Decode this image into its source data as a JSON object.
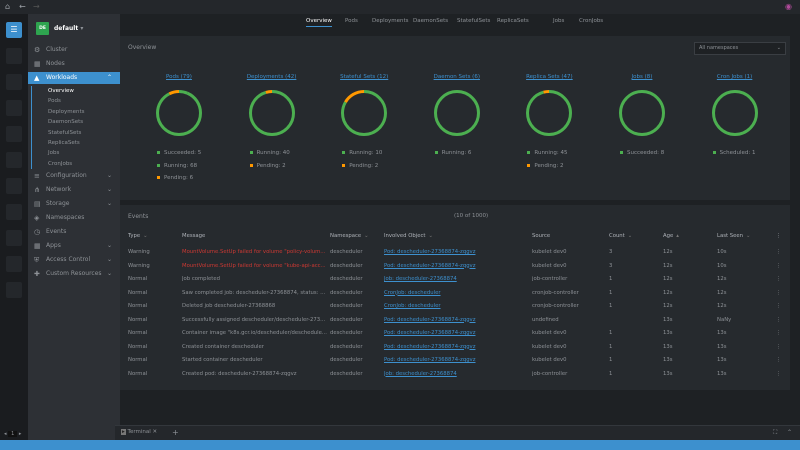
{
  "topbar": {
    "home_icon": "home-icon",
    "back_icon": "arrow-left-icon",
    "forward_icon": "arrow-right-icon"
  },
  "cluster": {
    "badge": "DE",
    "name": "default"
  },
  "sidebar": {
    "items": [
      {
        "label": "Cluster",
        "icon": "cluster-icon"
      },
      {
        "label": "Nodes",
        "icon": "nodes-icon"
      },
      {
        "label": "Workloads",
        "icon": "workloads-icon",
        "active": true
      },
      {
        "label": "Configuration",
        "icon": "configuration-icon"
      },
      {
        "label": "Network",
        "icon": "network-icon"
      },
      {
        "label": "Storage",
        "icon": "storage-icon"
      },
      {
        "label": "Namespaces",
        "icon": "namespaces-icon"
      },
      {
        "label": "Events",
        "icon": "events-icon"
      },
      {
        "label": "Apps",
        "icon": "apps-icon"
      },
      {
        "label": "Access Control",
        "icon": "access-control-icon"
      },
      {
        "label": "Custom Resources",
        "icon": "custom-resources-icon"
      }
    ],
    "workloads_sub": [
      "Overview",
      "Pods",
      "Deployments",
      "DaemonSets",
      "StatefulSets",
      "ReplicaSets",
      "Jobs",
      "CronJobs"
    ]
  },
  "tabs": [
    "Overview",
    "Pods",
    "Deployments",
    "DaemonSets",
    "StatefulSets",
    "ReplicaSets",
    "Jobs",
    "CronJobs"
  ],
  "overview": {
    "title": "Overview",
    "namespace_select": "All namespaces",
    "colors": {
      "green": "#4caf50",
      "orange": "#ff9800"
    },
    "cards": [
      {
        "title": "Pods (79)",
        "stats": [
          {
            "label": "Succeeded: 5",
            "v": 5,
            "c": "green"
          },
          {
            "label": "Running: 68",
            "v": 68,
            "c": "green"
          },
          {
            "label": "Pending: 6",
            "v": 6,
            "c": "orange"
          }
        ]
      },
      {
        "title": "Deployments (42)",
        "stats": [
          {
            "label": "Running: 40",
            "v": 40,
            "c": "green"
          },
          {
            "label": "Pending: 2",
            "v": 2,
            "c": "orange"
          }
        ]
      },
      {
        "title": "Stateful Sets (12)",
        "stats": [
          {
            "label": "Running: 10",
            "v": 10,
            "c": "green"
          },
          {
            "label": "Pending: 2",
            "v": 2,
            "c": "orange"
          }
        ]
      },
      {
        "title": "Daemon Sets (6)",
        "stats": [
          {
            "label": "Running: 6",
            "v": 6,
            "c": "green"
          }
        ]
      },
      {
        "title": "Replica Sets (47)",
        "stats": [
          {
            "label": "Running: 45",
            "v": 45,
            "c": "green"
          },
          {
            "label": "Pending: 2",
            "v": 2,
            "c": "orange"
          }
        ]
      },
      {
        "title": "Jobs (8)",
        "stats": [
          {
            "label": "Succeeded: 8",
            "v": 8,
            "c": "green"
          }
        ]
      },
      {
        "title": "Cron Jobs (1)",
        "stats": [
          {
            "label": "Scheduled: 1",
            "v": 1,
            "c": "green"
          }
        ]
      }
    ]
  },
  "events": {
    "title": "Events",
    "count": "(10 of 1000)",
    "columns": [
      "Type",
      "Message",
      "Namespace",
      "Involved Object",
      "Source",
      "Count",
      "Age",
      "Last Seen"
    ],
    "rows": [
      [
        "Warning",
        "MountVolume.SetUp failed for volume \"policy-volum...",
        "descheduler",
        "Pod: descheduler-27368874-zqgvz",
        "kubelet dev0",
        "3",
        "12s",
        "10s"
      ],
      [
        "Warning",
        "MountVolume.SetUp failed for volume \"kube-api-acc...",
        "descheduler",
        "Pod: descheduler-27368874-zqgvz",
        "kubelet dev0",
        "3",
        "12s",
        "10s"
      ],
      [
        "Normal",
        "Job completed",
        "descheduler",
        "Job: descheduler-27368874",
        "job-controller",
        "1",
        "12s",
        "12s"
      ],
      [
        "Normal",
        "Saw completed job: descheduler-27368874, status: C...",
        "descheduler",
        "CronJob: descheduler",
        "cronjob-controller",
        "1",
        "12s",
        "12s"
      ],
      [
        "Normal",
        "Deleted job descheduler-27368868",
        "descheduler",
        "CronJob: descheduler",
        "cronjob-controller",
        "1",
        "12s",
        "12s"
      ],
      [
        "Normal",
        "Successfully assigned descheduler/descheduler-273...",
        "descheduler",
        "Pod: descheduler-27368874-zqgvz",
        "undefined",
        "",
        "13s",
        "NaNy"
      ],
      [
        "Normal",
        "Container image \"k8s.gcr.io/descheduler/deschedule...",
        "descheduler",
        "Pod: descheduler-27368874-zqgvz",
        "kubelet dev0",
        "1",
        "13s",
        "13s"
      ],
      [
        "Normal",
        "Created container descheduler",
        "descheduler",
        "Pod: descheduler-27368874-zqgvz",
        "kubelet dev0",
        "1",
        "13s",
        "13s"
      ],
      [
        "Normal",
        "Started container descheduler",
        "descheduler",
        "Pod: descheduler-27368874-zqgvz",
        "kubelet dev0",
        "1",
        "13s",
        "13s"
      ],
      [
        "Normal",
        "Created pod: descheduler-27368874-zqgvz",
        "descheduler",
        "Job: descheduler-27368874",
        "job-controller",
        "1",
        "13s",
        "13s"
      ]
    ]
  },
  "dock": {
    "terminal_label": "Terminal"
  },
  "pager": {
    "page": "1"
  }
}
